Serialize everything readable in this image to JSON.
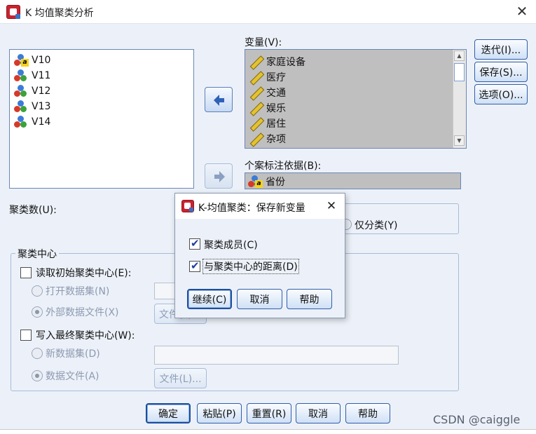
{
  "window": {
    "title": "K 均值聚类分析",
    "close_glyph": "✕"
  },
  "source_list": {
    "items": [
      {
        "label": "V10"
      },
      {
        "label": "V11"
      },
      {
        "label": "V12"
      },
      {
        "label": "V13"
      },
      {
        "label": "V14"
      }
    ]
  },
  "variables": {
    "label": "变量(V):",
    "items": [
      {
        "label": "家庭设备"
      },
      {
        "label": "医疗"
      },
      {
        "label": "交通"
      },
      {
        "label": "娱乐"
      },
      {
        "label": "居住"
      },
      {
        "label": "杂项"
      }
    ]
  },
  "case_label": {
    "label": "个案标注依据(B):",
    "value": "省份"
  },
  "side_buttons": {
    "iterate": "迭代(I)...",
    "save": "保存(S)...",
    "options": "选项(O)..."
  },
  "cluster_count": {
    "label": "聚类数(U):",
    "classify_only": "仅分类(Y)"
  },
  "cluster_centers": {
    "group_label": "聚类中心",
    "read_initial": "读取初始聚类中心(E):",
    "open_dataset": "打开数据集(N)",
    "external_file": "外部数据文件(X)",
    "file_button_1": "文件(L)...",
    "write_final": "写入最终聚类中心(W):",
    "new_dataset": "新数据集(D)",
    "data_file": "数据文件(A)",
    "file_button_2": "文件(L)..."
  },
  "bottom_buttons": {
    "ok": "确定",
    "paste": "粘贴(P)",
    "reset": "重置(R)",
    "cancel": "取消",
    "help": "帮助"
  },
  "dialog": {
    "title": "K-均值聚类：保存新变量",
    "close_glyph": "✕",
    "membership": "聚类成员(C)",
    "distance": "与聚类中心的距离(D)",
    "continue": "继续(C)",
    "cancel": "取消",
    "help": "帮助"
  },
  "watermark": "CSDN @caiggle"
}
